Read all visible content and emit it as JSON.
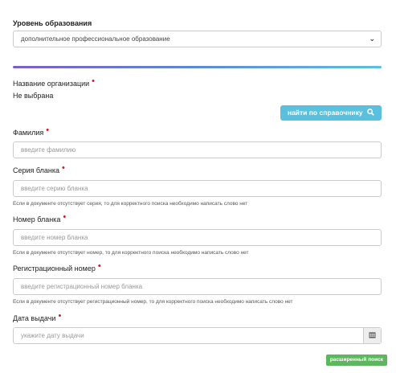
{
  "education": {
    "label": "Уровень образования",
    "selected": "дополнительное профессиональное образование"
  },
  "organization": {
    "label": "Название организации",
    "value": "Не выбрана",
    "lookup_button": "найти по справочнику"
  },
  "surname": {
    "label": "Фамилия",
    "placeholder": "введите фамилию"
  },
  "series": {
    "label": "Серия бланка",
    "placeholder": "введите серию бланка",
    "hint": "Если в документе отсутствует серия, то для корректного поиска необходимо написать слово нет"
  },
  "number": {
    "label": "Номер бланка",
    "placeholder": "введите номер бланка",
    "hint": "Если в документе отсутствует номер, то для корректного поиска необходимо написать слово нет"
  },
  "regnumber": {
    "label": "Регистрационный номер",
    "placeholder": "введите регистрационный номер бланка",
    "hint": "Если в документе отсутствует регистрационный номер, то для корректного поиска необходимо написать слово нет"
  },
  "issue_date": {
    "label": "Дата выдачи",
    "placeholder": "укажите дату выдачи"
  },
  "advanced_button": "расширенный поиск",
  "required_mark": "•",
  "icons": {
    "dropdown": "chevron-down-icon",
    "search": "search-icon",
    "calendar": "calendar-icon"
  },
  "colors": {
    "accent_blue": "#5bc0de",
    "accent_green": "#5cb85c",
    "required_red": "#d9141f"
  }
}
